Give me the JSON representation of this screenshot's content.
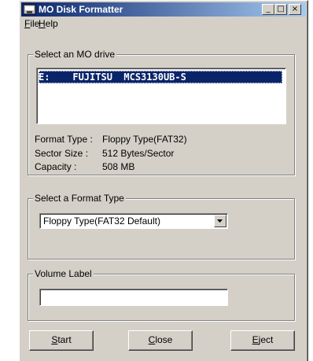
{
  "window": {
    "title": "MO Disk Formatter",
    "controls": {
      "minimize": "_",
      "maximize": "□",
      "close": "×"
    }
  },
  "menu": [
    {
      "hotkey": "F",
      "rest": "ile"
    },
    {
      "hotkey": "H",
      "rest": "elp"
    }
  ],
  "drive_group": {
    "label": "Select an MO drive",
    "selected_drive": "E:    FUJITSU  MCS3130UB-S",
    "info": [
      {
        "label": "Format Type :",
        "value": "Floppy Type(FAT32)"
      },
      {
        "label": "Sector Size :",
        "value": "512 Bytes/Sector"
      },
      {
        "label": "Capacity :",
        "value": "508 MB"
      }
    ]
  },
  "format_group": {
    "label": "Select a Format Type",
    "selected": "Floppy Type(FAT32 Default)"
  },
  "volume_group": {
    "label": "Volume Label",
    "value": ""
  },
  "buttons": [
    {
      "hotkey": "S",
      "rest": "tart"
    },
    {
      "hotkey": "C",
      "rest": "lose"
    },
    {
      "hotkey": "E",
      "rest": "ject"
    }
  ],
  "icons": {
    "app": "mo-disk-app-icon",
    "dropdown": "chevron-down-icon"
  },
  "colors": {
    "titlebar_active": "#0a246a",
    "selection": "#0a246a",
    "face": "#d4d0c8"
  }
}
